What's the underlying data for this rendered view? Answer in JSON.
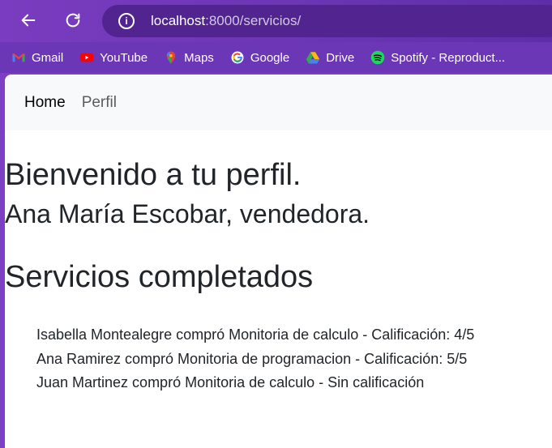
{
  "browser": {
    "url_host": "localhost",
    "url_path": ":8000/servicios/",
    "bookmarks": [
      {
        "label": "Gmail",
        "icon": "gmail-icon"
      },
      {
        "label": "YouTube",
        "icon": "youtube-icon"
      },
      {
        "label": "Maps",
        "icon": "maps-icon"
      },
      {
        "label": "Google",
        "icon": "google-icon"
      },
      {
        "label": "Drive",
        "icon": "drive-icon"
      },
      {
        "label": "Spotify - Reproduct...",
        "icon": "spotify-icon"
      }
    ],
    "colors": {
      "toolbar": "#7a3cc0",
      "omnibox": "#51248f"
    }
  },
  "navbar": {
    "home": "Home",
    "perfil": "Perfil"
  },
  "page": {
    "welcome": "Bienvenido a tu perfil.",
    "user_line": "Ana María Escobar, vendedora.",
    "section_title": "Servicios completados",
    "services": [
      "Isabella Montealegre compró Monitoria de calculo - Calificación: 4/5",
      "Ana Ramirez compró Monitoria de programacion - Calificación: 5/5",
      "Juan Martinez compró Monitoria de calculo - Sin calificación"
    ]
  }
}
